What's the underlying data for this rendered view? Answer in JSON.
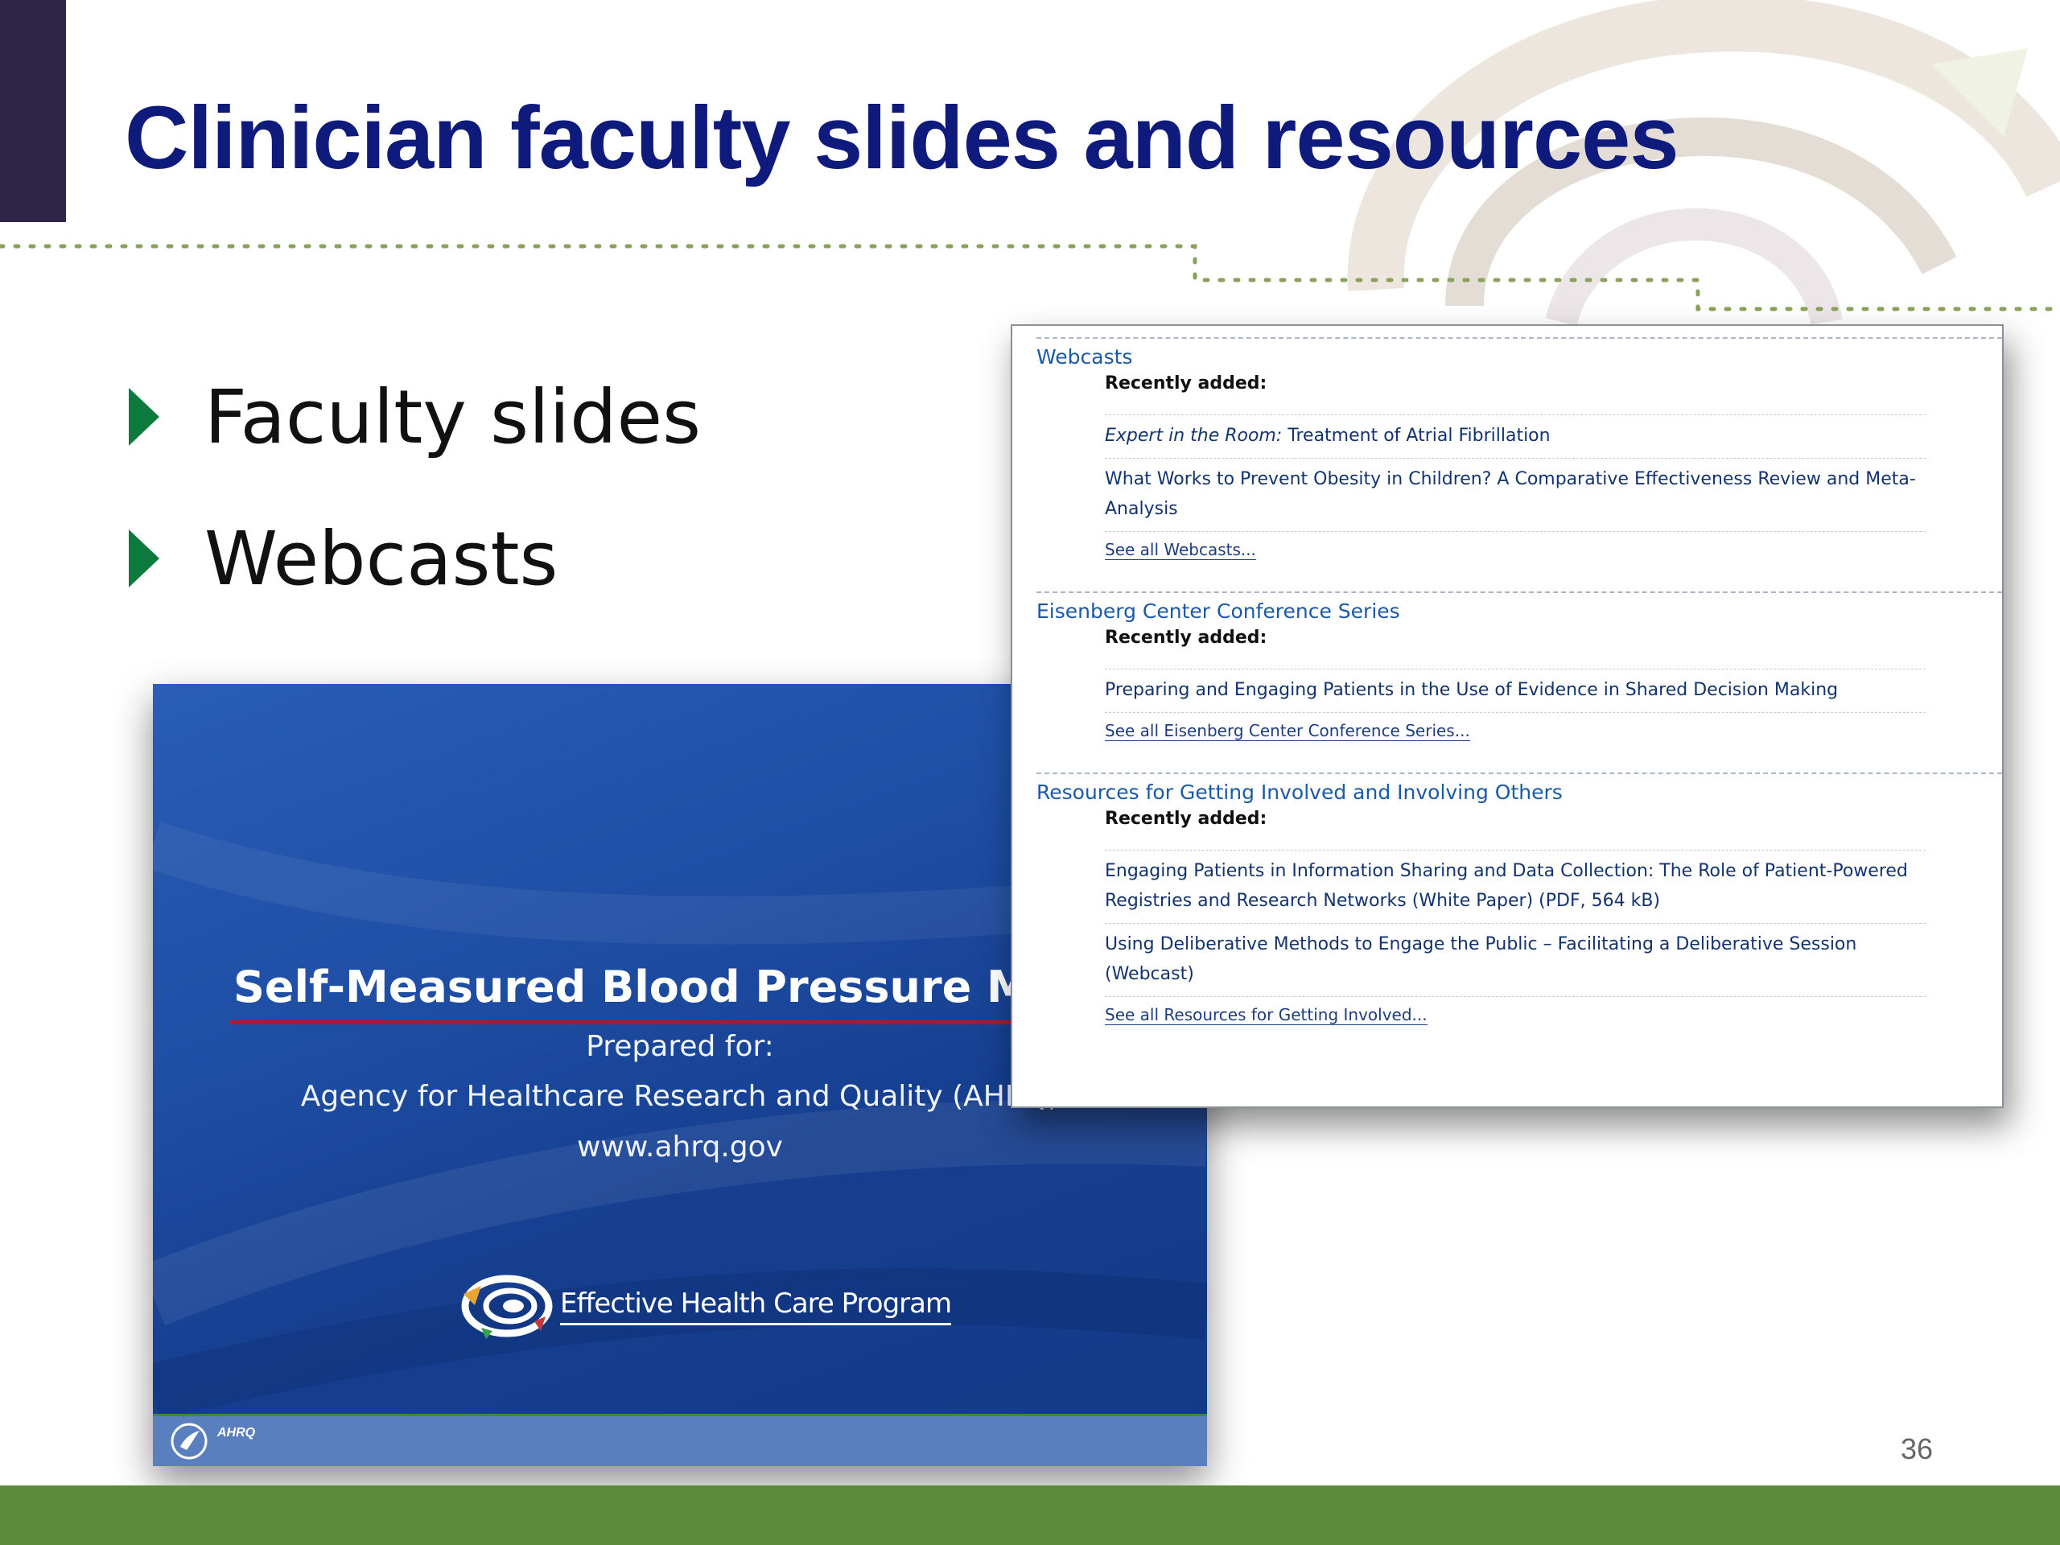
{
  "slide": {
    "title": "Clinician faculty slides and resources",
    "bullets": [
      "Faculty slides",
      "Webcasts"
    ],
    "page_number": "36"
  },
  "thumbnail": {
    "title": "Self-Measured Blood Pressure Moni",
    "prepared_for": "Prepared for:",
    "agency": "Agency for Healthcare Research and Quality (AHRQ)",
    "website": "www.ahrq.gov",
    "program": "Effective Health Care Program",
    "footer_logo": "AHRQ"
  },
  "webpage": {
    "sections": [
      {
        "heading": "Webcasts",
        "recently_added": "Recently added:",
        "items": [
          {
            "italic": "Expert in the Room:",
            "text": " Treatment of Atrial Fibrillation"
          },
          {
            "italic": "",
            "text": "What Works to Prevent Obesity in Children? A Comparative Effectiveness Review and Meta-Analysis"
          }
        ],
        "see_all": "See all Webcasts..."
      },
      {
        "heading": "Eisenberg Center Conference Series",
        "recently_added": "Recently added:",
        "items": [
          {
            "italic": "",
            "text": "Preparing and Engaging Patients in the Use of Evidence in Shared Decision Making"
          }
        ],
        "see_all": "See all Eisenberg Center Conference Series..."
      },
      {
        "heading": "Resources for Getting Involved and Involving Others",
        "recently_added": "Recently added:",
        "items": [
          {
            "italic": "",
            "text": "Engaging Patients in Information Sharing and Data Collection: The Role of Patient-Powered Registries and Research Networks (White Paper) (PDF, 564 kB)"
          },
          {
            "italic": "",
            "text": "Using Deliberative Methods to Engage the Public – Facilitating a Deliberative Session (Webcast)"
          }
        ],
        "see_all": "See all Resources for Getting Involved..."
      }
    ]
  },
  "colors": {
    "title": "#0e1b7c",
    "bullet": "#0c7a3c",
    "footer_bar": "#5b8a3b",
    "corner_block": "#2f2547",
    "link": "#1a5aa6"
  }
}
